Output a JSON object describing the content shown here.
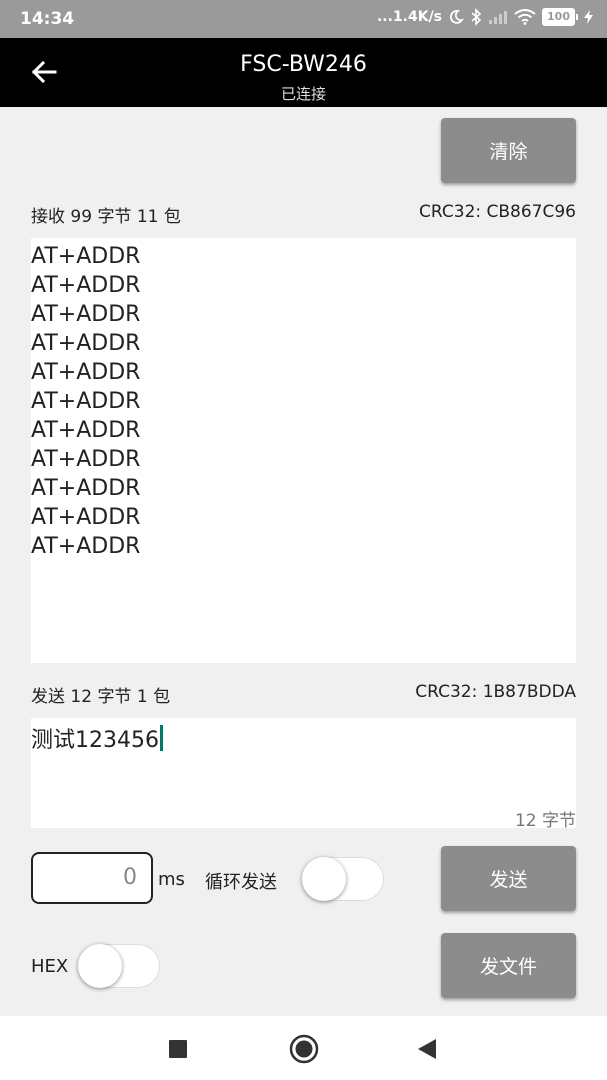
{
  "status_bar": {
    "time": "14:34",
    "network_speed": "...1.4K/s",
    "battery": "100",
    "icons": [
      "moon-icon",
      "bluetooth-icon",
      "signal-icon",
      "wifi-icon",
      "battery-icon",
      "charging-icon"
    ]
  },
  "app_bar": {
    "title": "FSC-BW246",
    "subtitle": "已连接",
    "back_icon": "arrow-left-icon"
  },
  "clear_button": "清除",
  "receive": {
    "label": "接收 99 字节 11 包",
    "crc": "CRC32: CB867C96",
    "lines": [
      "AT+ADDR",
      "AT+ADDR",
      "AT+ADDR",
      "AT+ADDR",
      "AT+ADDR",
      "AT+ADDR",
      "AT+ADDR",
      "AT+ADDR",
      "AT+ADDR",
      "AT+ADDR",
      "AT+ADDR"
    ]
  },
  "send": {
    "label": "发送 12 字节 1 包",
    "crc": "CRC32: 1B87BDDA",
    "text": "测试123456",
    "byte_count": "12 字节"
  },
  "interval": {
    "value": "0",
    "unit": "ms"
  },
  "loop_send": {
    "label": "循环发送",
    "on": false
  },
  "send_button": "发送",
  "hex": {
    "label": "HEX",
    "on": false
  },
  "send_file_button": "发文件",
  "nav": [
    "square-icon",
    "circle-icon",
    "triangle-back-icon"
  ],
  "colors": {
    "status_bar": "#9a9a9a",
    "app_bar": "#000000",
    "button": "#8c8c8c",
    "background": "#f0f0f0",
    "cursor": "#00796b"
  }
}
